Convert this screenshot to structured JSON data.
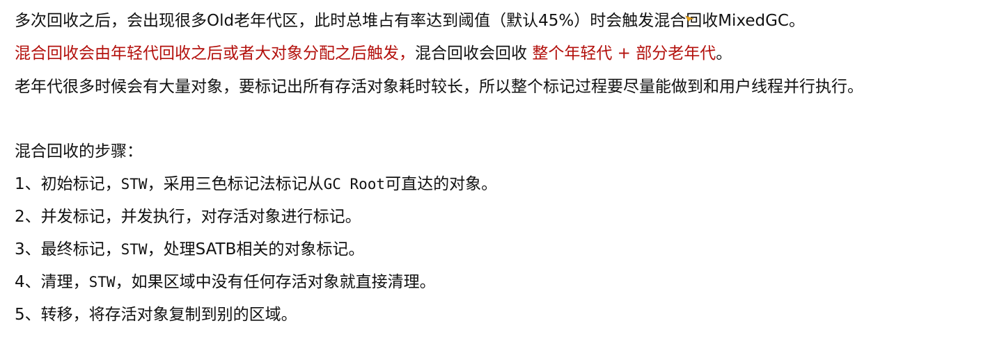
{
  "paragraph": {
    "line1": "多次回收之后，会出现很多Old老年代区，此时总堆占有率达到阈值（默认45%）时会触发混合回收MixedGC。",
    "line2_red_a": "混合回收会由年轻代回收之后或者大对象分配之后触发，",
    "line2_plain": "混合回收会回收 ",
    "line2_red_b": "整个年轻代 + 部分老年代",
    "line2_end": "。",
    "line3": "老年代很多时候会有大量对象，要标记出所有存活对象耗时较长，所以整个标记过程要尽量能做到和用户线程并行执行。"
  },
  "steps": {
    "heading": "混合回收的步骤：",
    "items": [
      {
        "num": "1、",
        "a": "初始标记，",
        "mono1": "STW",
        "b": "，采用三色标记法标记从",
        "mono2": "GC Root",
        "c": "可直达的对象。"
      },
      {
        "num": "2、",
        "a": "并发标记，并发执行，对存活对象进行标记。"
      },
      {
        "num": "3、",
        "a": "最终标记，",
        "mono1": "STW",
        "b": "，处理SATB相关的对象标记。"
      },
      {
        "num": "4、",
        "a": "清理，",
        "mono1": "STW",
        "b": "，如果区域中没有任何存活对象就直接清理。"
      },
      {
        "num": "5、",
        "a": "转移，将存活对象复制到别的区域。"
      }
    ]
  },
  "colors": {
    "text": "#111111",
    "highlight_red": "#b3100c",
    "cursor": "#e8a21a"
  },
  "icons": {
    "cursor": "mouse-cursor-icon"
  }
}
